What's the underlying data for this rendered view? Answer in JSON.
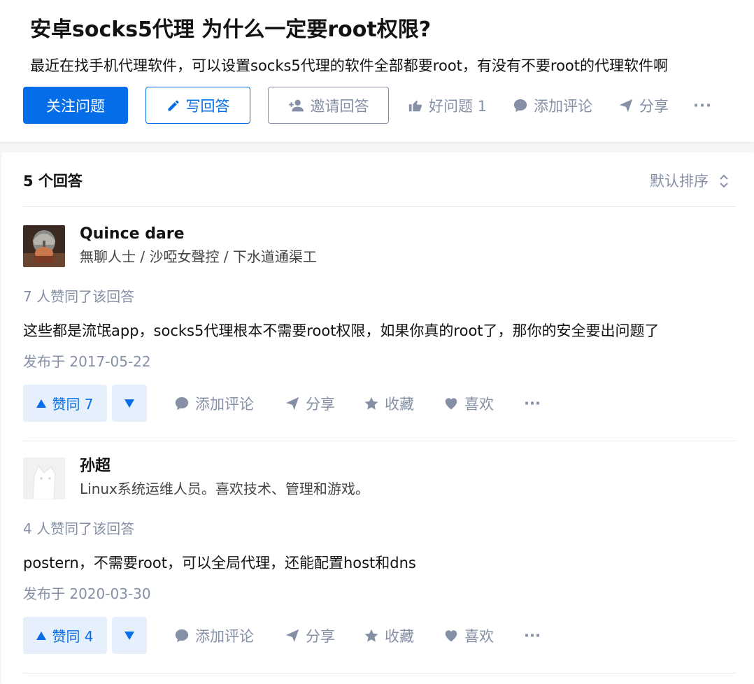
{
  "question": {
    "title": "安卓socks5代理 为什么一定要root权限?",
    "description": "最近在找手机代理软件，可以设置socks5代理的软件全部都要root，有没有不要root的代理软件啊",
    "follow_label": "关注问题",
    "write_label": "写回答",
    "invite_label": "邀请回答",
    "good_question_label": "好问题 1",
    "comment_label": "添加评论",
    "share_label": "分享",
    "more_label": "···"
  },
  "answers_header": {
    "count_label": "5 个回答",
    "sort_label": "默认排序"
  },
  "answers": [
    {
      "author": "Quince dare",
      "headline": "無聊人士 / 沙啞女聲控 / 下水道通渠工",
      "votes_text": "7 人赞同了该回答",
      "content": "这些都是流氓app，socks5代理根本不需要root权限，如果你真的root了，那你的安全要出问题了",
      "date": "发布于 2017-05-22",
      "vote_label": "赞同 7",
      "comment_label": "添加评论",
      "share_label": "分享",
      "collect_label": "收藏",
      "like_label": "喜欢",
      "more_label": "···"
    },
    {
      "author": "孙超",
      "headline": "Linux系统运维人员。喜欢技术、管理和游戏。",
      "votes_text": "4 人赞同了该回答",
      "content": "postern，不需要root，可以全局代理，还能配置host和dns",
      "date": "发布于 2020-03-30",
      "vote_label": "赞同 4",
      "comment_label": "添加评论",
      "share_label": "分享",
      "collect_label": "收藏",
      "like_label": "喜欢",
      "more_label": "···"
    }
  ],
  "colors": {
    "brand_blue": "#056de8",
    "meta_gray": "#8590a6",
    "text": "#121212"
  }
}
